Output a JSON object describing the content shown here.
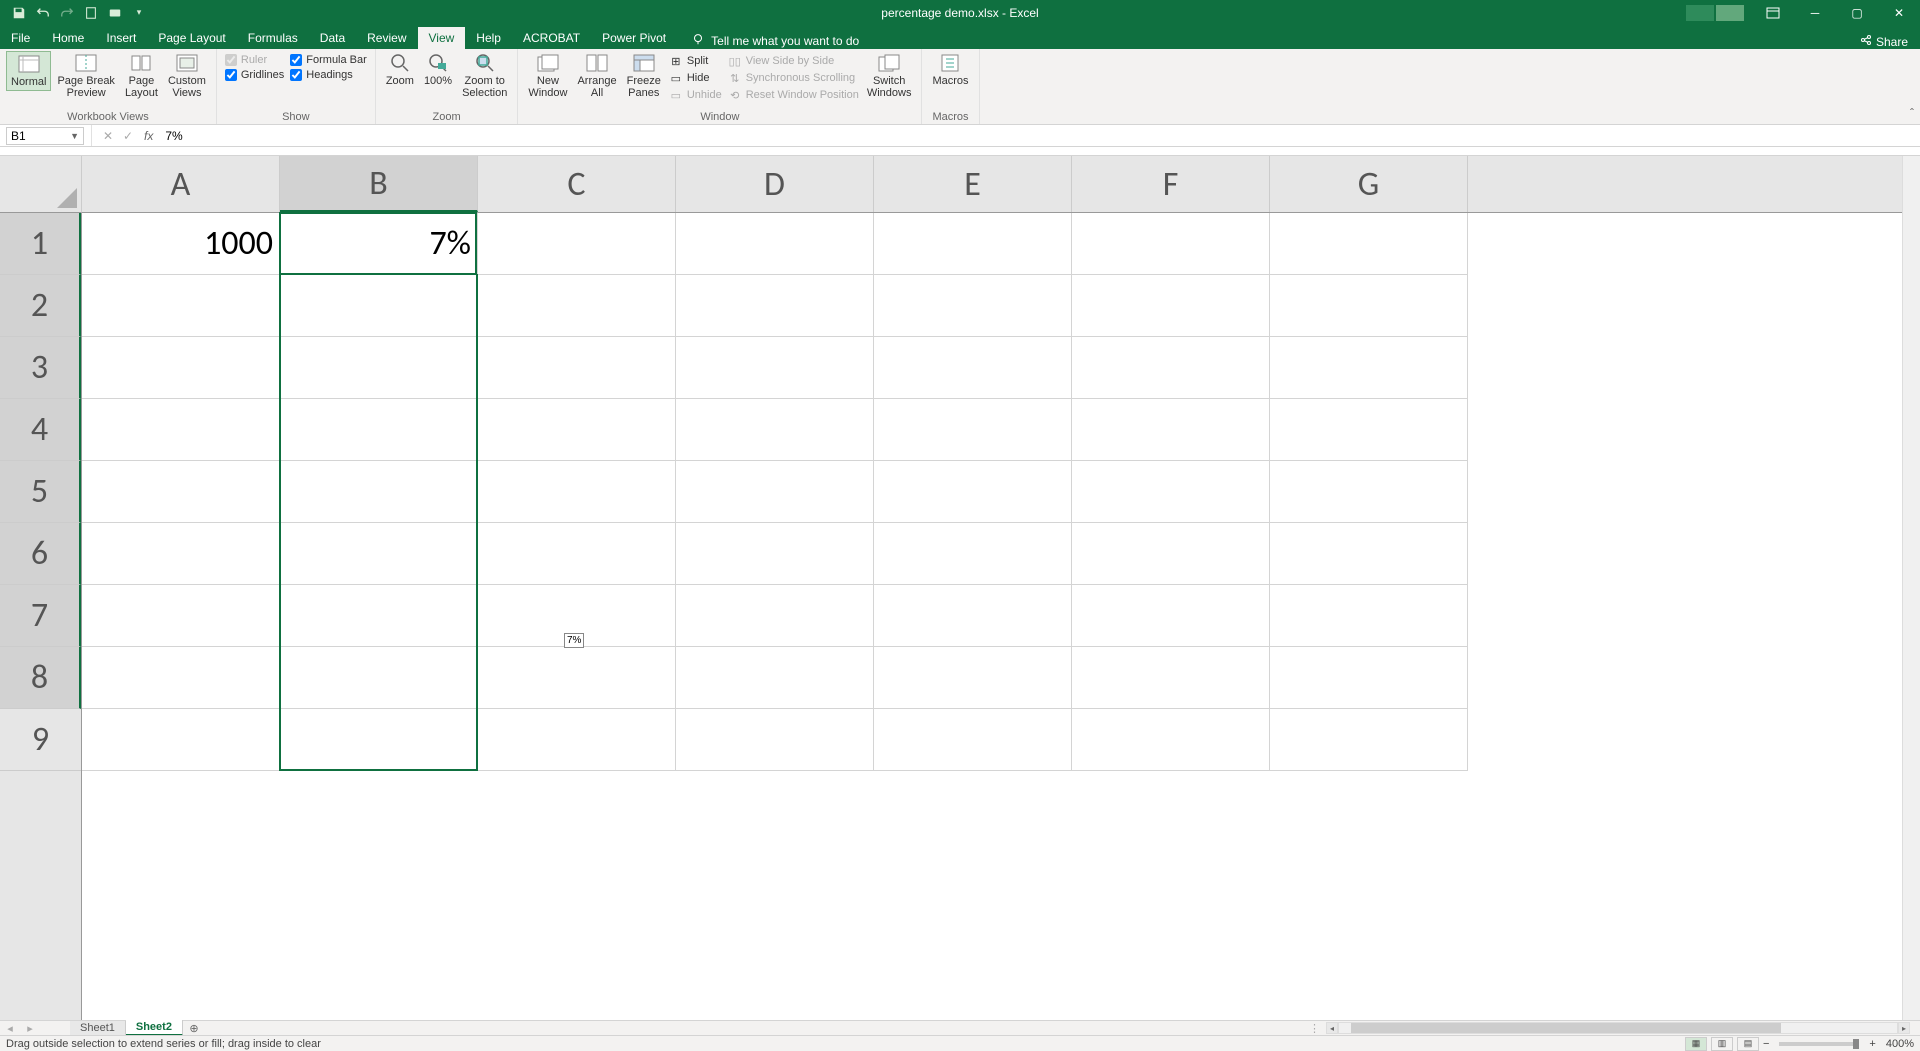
{
  "title": "percentage demo.xlsx - Excel",
  "menu": {
    "file": "File",
    "home": "Home",
    "insert": "Insert",
    "page_layout": "Page Layout",
    "formulas": "Formulas",
    "data": "Data",
    "review": "Review",
    "view": "View",
    "help": "Help",
    "acrobat": "ACROBAT",
    "power_pivot": "Power Pivot",
    "tell_me": "Tell me what you want to do",
    "share": "Share"
  },
  "ribbon": {
    "workbook_views": {
      "label": "Workbook Views",
      "normal": "Normal",
      "page_break": "Page Break\nPreview",
      "page_layout": "Page\nLayout",
      "custom": "Custom\nViews"
    },
    "show": {
      "label": "Show",
      "ruler": "Ruler",
      "formula_bar": "Formula Bar",
      "gridlines": "Gridlines",
      "headings": "Headings"
    },
    "zoom": {
      "label": "Zoom",
      "zoom": "Zoom",
      "hundred": "100%",
      "to_selection": "Zoom to\nSelection"
    },
    "window": {
      "label": "Window",
      "new_window": "New\nWindow",
      "arrange_all": "Arrange\nAll",
      "freeze": "Freeze\nPanes",
      "split": "Split",
      "hide": "Hide",
      "unhide": "Unhide",
      "side_by_side": "View Side by Side",
      "sync_scroll": "Synchronous Scrolling",
      "reset_pos": "Reset Window Position",
      "switch": "Switch\nWindows"
    },
    "macros": {
      "label": "Macros",
      "macros": "Macros"
    }
  },
  "formula_bar": {
    "name_box": "B1",
    "formula": "7%"
  },
  "columns": [
    "A",
    "B",
    "C",
    "D",
    "E",
    "F",
    "G"
  ],
  "rows": [
    "1",
    "2",
    "3",
    "4",
    "5",
    "6",
    "7",
    "8",
    "9"
  ],
  "cells": {
    "A1": "1000",
    "B1": "7%"
  },
  "drag_tooltip": "7%",
  "sheets": {
    "sheet1": "Sheet1",
    "sheet2": "Sheet2"
  },
  "status": {
    "message": "Drag outside selection to extend series or fill; drag inside to clear",
    "zoom": "400%"
  },
  "selected_cell": "B1",
  "selected_column_index": 1,
  "selected_row_indices": [
    0,
    1,
    2,
    3,
    4,
    5,
    6,
    7
  ]
}
